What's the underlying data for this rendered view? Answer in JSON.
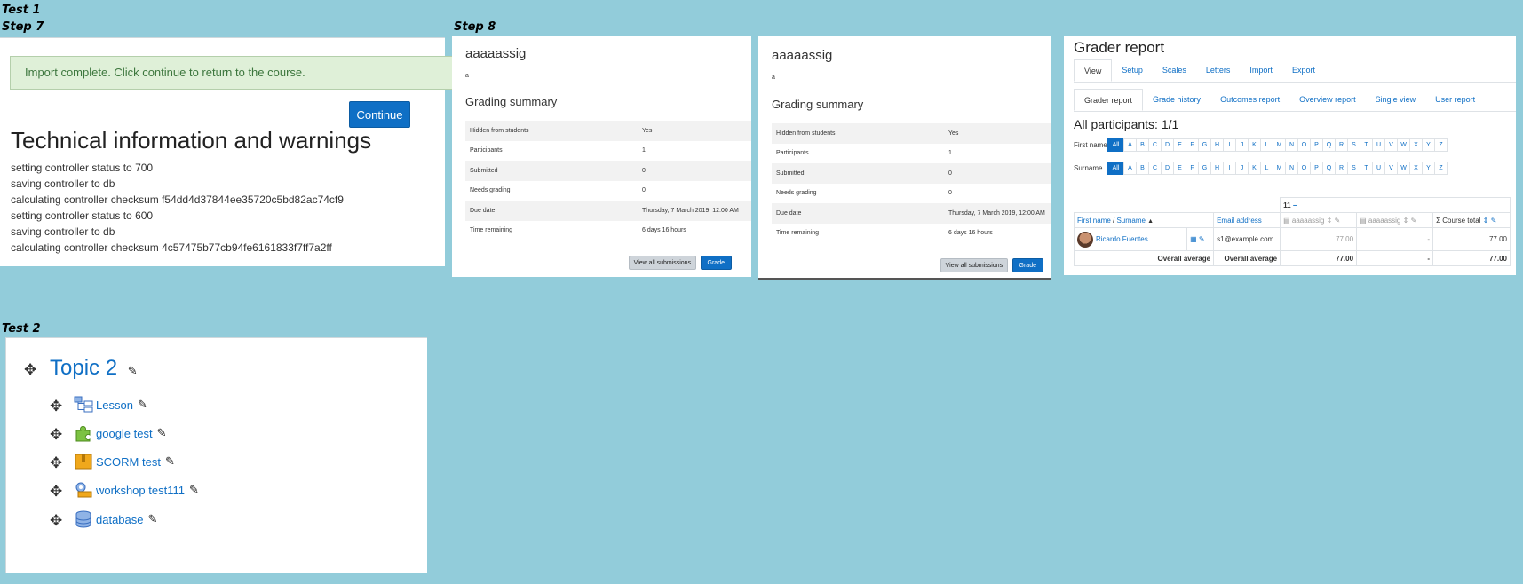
{
  "labels": {
    "test1": "Test 1",
    "step7": "Step 7",
    "step8": "Step 8",
    "test2": "Test 2"
  },
  "step7": {
    "alert": "Import complete. Click continue to return to the course.",
    "continue_label": "Continue",
    "tech_title": "Technical information and warnings",
    "log": [
      "setting controller status to 700",
      "saving controller to db",
      "calculating controller checksum f54dd4d37844ee35720c5bd82ac74cf9",
      "setting controller status to 600",
      "saving controller to db",
      "calculating controller checksum 4c57475b77cb94fe6161833f7ff7a2ff"
    ]
  },
  "assignments": [
    {
      "title": "aaaaassig",
      "description": "a",
      "summary_title": "Grading summary",
      "rows": [
        [
          "Hidden from students",
          "Yes"
        ],
        [
          "Participants",
          "1"
        ],
        [
          "Submitted",
          "0"
        ],
        [
          "Needs grading",
          "0"
        ],
        [
          "Due date",
          "Thursday, 7 March 2019, 12:00 AM"
        ],
        [
          "Time remaining",
          "6 days 16 hours"
        ]
      ],
      "view_all": "View all submissions",
      "grade": "Grade"
    },
    {
      "title": "aaaaassig",
      "description": "a",
      "summary_title": "Grading summary",
      "rows": [
        [
          "Hidden from students",
          "Yes"
        ],
        [
          "Participants",
          "1"
        ],
        [
          "Submitted",
          "0"
        ],
        [
          "Needs grading",
          "0"
        ],
        [
          "Due date",
          "Thursday, 7 March 2019, 12:00 AM"
        ],
        [
          "Time remaining",
          "6 days 16 hours"
        ]
      ],
      "view_all": "View all submissions",
      "grade": "Grade"
    }
  ],
  "grader": {
    "title": "Grader report",
    "tabs1": [
      "View",
      "Setup",
      "Scales",
      "Letters",
      "Import",
      "Export"
    ],
    "tabs2": [
      "Grader report",
      "Grade history",
      "Outcomes report",
      "Overview report",
      "Single view",
      "User report"
    ],
    "participants": "All participants: 1/1",
    "first_name_label": "First name",
    "surname_label": "Surname",
    "all_label": "All",
    "letters": [
      "A",
      "B",
      "C",
      "D",
      "E",
      "F",
      "G",
      "H",
      "I",
      "J",
      "K",
      "L",
      "M",
      "N",
      "O",
      "P",
      "Q",
      "R",
      "S",
      "T",
      "U",
      "V",
      "W",
      "X",
      "Y",
      "Z"
    ],
    "category": "11",
    "col_first": "First name",
    "col_sep": " / ",
    "col_surname": "Surname",
    "col_email": "Email address",
    "col_item1": "aaaaassig",
    "col_item2": "aaaaassig",
    "col_total": "Course total",
    "student": "Ricardo Fuentes",
    "email": "s1@example.com",
    "grade1": "77.00",
    "grade2": "-",
    "total": "77.00",
    "avg_label1": "Overall average",
    "avg_label2": "Overall average",
    "avg1": "77.00",
    "avg2": "-",
    "avg_total": "77.00",
    "accent": "#0f6fc5"
  },
  "topic": {
    "title": "Topic 2",
    "activities": [
      {
        "name": "Lesson",
        "icon": "lesson-icon"
      },
      {
        "name": "google test",
        "icon": "puzzle-icon"
      },
      {
        "name": "SCORM test",
        "icon": "scorm-package-icon"
      },
      {
        "name": "workshop test111",
        "icon": "workshop-icon"
      },
      {
        "name": "database",
        "icon": "database-icon"
      }
    ]
  }
}
